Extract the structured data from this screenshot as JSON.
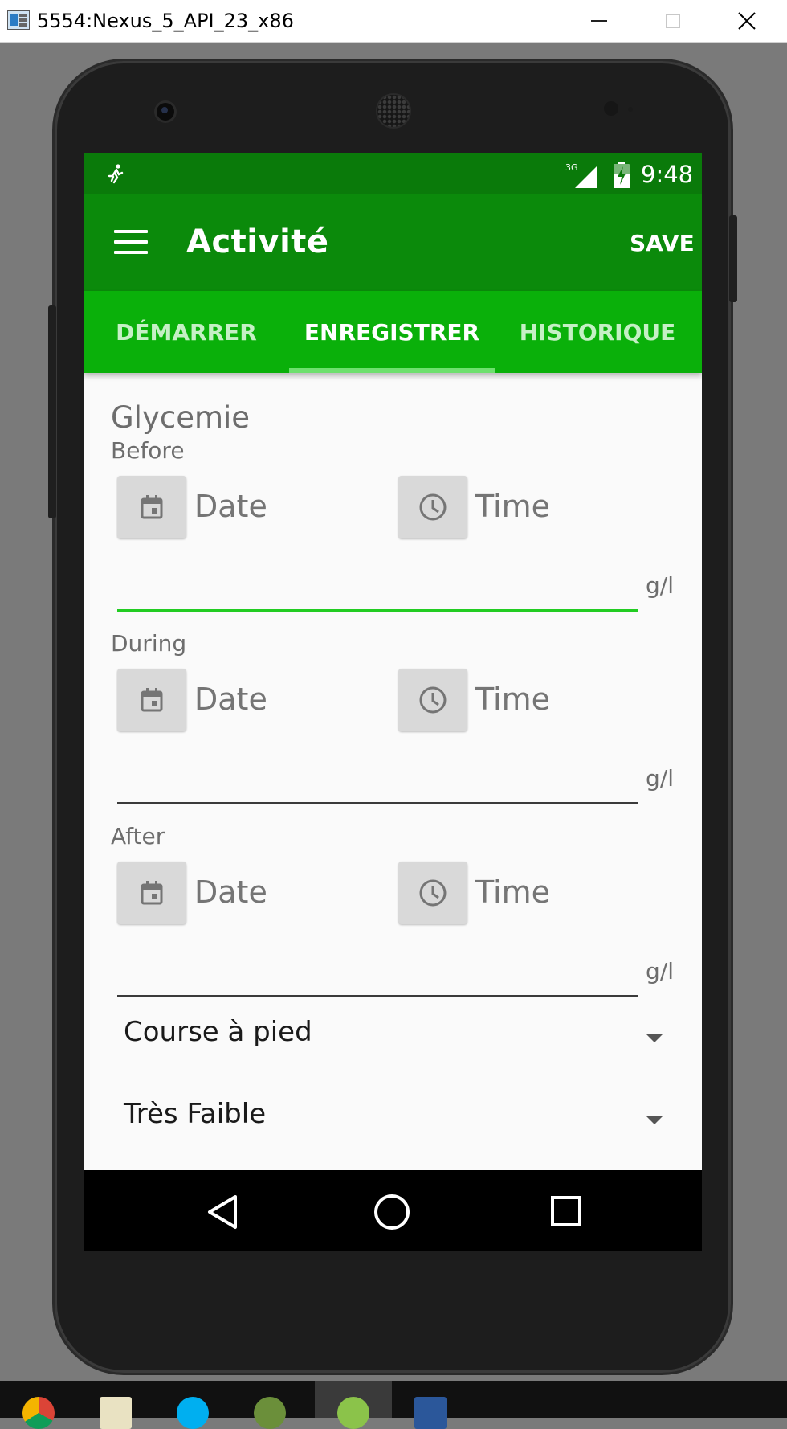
{
  "window": {
    "title": "5554:Nexus_5_API_23_x86",
    "buttons": [
      "minimize",
      "maximize",
      "close"
    ]
  },
  "status_bar": {
    "time": "9:48",
    "network": "3G",
    "icons": [
      "running-icon",
      "signal-icon",
      "battery-charging-icon"
    ]
  },
  "app_bar": {
    "title": "Activité",
    "action": "SAVE"
  },
  "tabs": [
    {
      "label": "DÉMARRER",
      "active": false
    },
    {
      "label": "ENREGISTRER",
      "active": true
    },
    {
      "label": "HISTORIQUE",
      "active": false
    }
  ],
  "form": {
    "section_title": "Glycemie",
    "phases": [
      {
        "label": "Before",
        "date_label": "Date",
        "time_label": "Time",
        "unit": "g/l",
        "focused": true
      },
      {
        "label": "During",
        "date_label": "Date",
        "time_label": "Time",
        "unit": "g/l",
        "focused": false
      },
      {
        "label": "After",
        "date_label": "Date",
        "time_label": "Time",
        "unit": "g/l",
        "focused": false
      }
    ],
    "activity_spinner": "Course à pied",
    "intensity_spinner": "Très Faible"
  },
  "colors": {
    "status_bar": "#0a7a0a",
    "app_bar": "#0b8a0b",
    "tab_bar": "#0ab00a",
    "focus_line": "#22cc22"
  }
}
